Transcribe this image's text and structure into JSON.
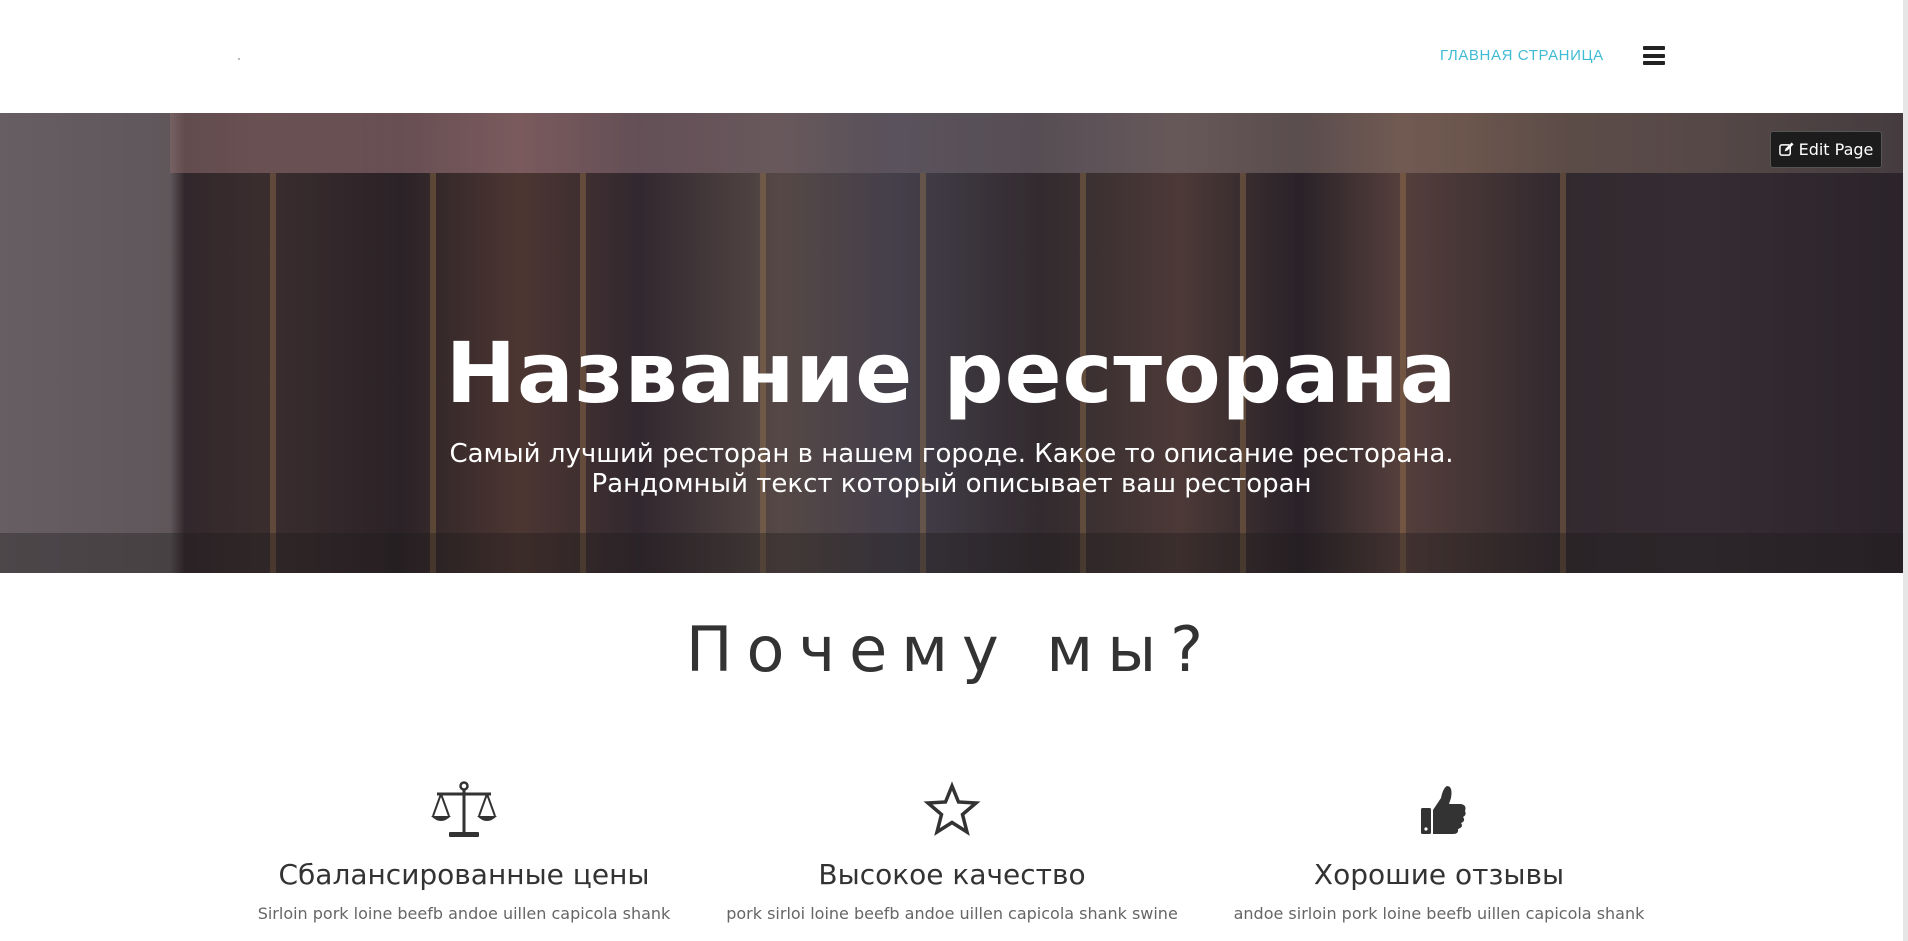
{
  "header": {
    "nav_link": "ГЛАВНАЯ СТРАНИЦА",
    "accent_color": "#3fbbd4",
    "menu_icon": "hamburger-icon"
  },
  "hero": {
    "title": "Название ресторана",
    "subtitle_line1": "Самый лучший ресторан в нашем городе. Какое то описание ресторана.",
    "subtitle_line2": "Рандомный текст который описывает ваш ресторан",
    "edit_button": "Edit Page",
    "edit_icon": "edit-icon"
  },
  "why": {
    "title": "Почему мы?",
    "features": [
      {
        "icon": "scales-icon",
        "title": "Сбалансированные цены",
        "text": "Sirloin pork loine beefb andoe uillen capicola shank"
      },
      {
        "icon": "star-icon",
        "title": "Высокое качество",
        "text": "pork sirloi loine beefb andoe uillen capicola shank swine"
      },
      {
        "icon": "thumbs-up-icon",
        "title": "Хорошие отзывы",
        "text": "andoe sirloin pork loine beefb uillen capicola shank"
      }
    ]
  }
}
